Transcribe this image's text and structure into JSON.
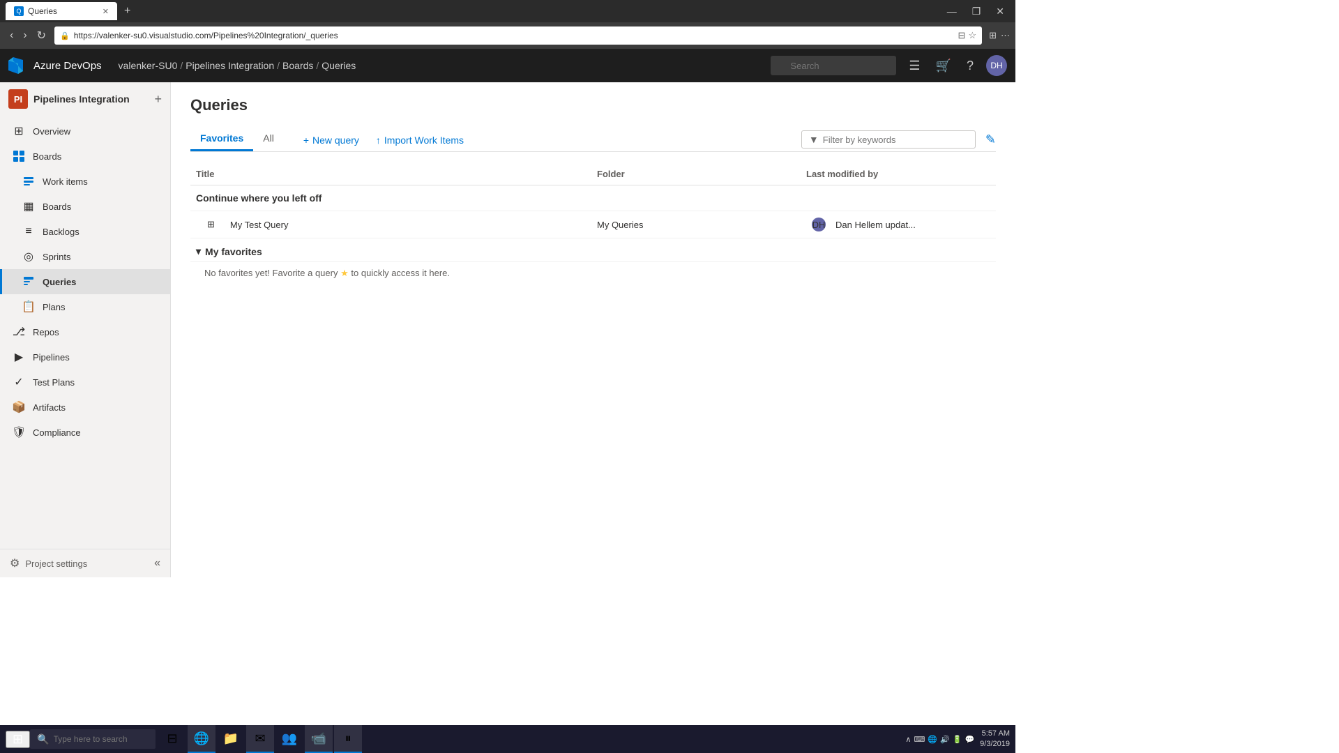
{
  "browser": {
    "tab_title": "Queries",
    "tab_icon": "Q",
    "url": "https://valenker-su0.visualstudio.com/Pipelines%20Integration/_queries",
    "new_tab_label": "+",
    "win_minimize": "—",
    "win_maximize": "❐",
    "win_close": "✕"
  },
  "topnav": {
    "brand": "Azure DevOps",
    "breadcrumb": [
      {
        "label": "valenker-SU0",
        "href": "#"
      },
      {
        "label": "Pipelines Integration",
        "href": "#"
      },
      {
        "label": "Boards",
        "href": "#"
      },
      {
        "label": "Queries",
        "href": "#"
      }
    ],
    "search_placeholder": "Search",
    "avatar_initials": "DH"
  },
  "sidebar": {
    "project_name": "Pipelines Integration",
    "project_icon": "PI",
    "nav_items": [
      {
        "id": "overview",
        "label": "Overview",
        "icon": "⊞"
      },
      {
        "id": "boards",
        "label": "Boards",
        "icon": "⊟"
      },
      {
        "id": "work-items",
        "label": "Work items",
        "icon": "☑"
      },
      {
        "id": "boards2",
        "label": "Boards",
        "icon": "▦"
      },
      {
        "id": "backlogs",
        "label": "Backlogs",
        "icon": "≡"
      },
      {
        "id": "sprints",
        "label": "Sprints",
        "icon": "◎"
      },
      {
        "id": "queries",
        "label": "Queries",
        "icon": "⊞",
        "active": true
      },
      {
        "id": "plans",
        "label": "Plans",
        "icon": "📋"
      },
      {
        "id": "repos",
        "label": "Repos",
        "icon": "⎇"
      },
      {
        "id": "pipelines",
        "label": "Pipelines",
        "icon": "▶"
      },
      {
        "id": "test-plans",
        "label": "Test Plans",
        "icon": "✓"
      },
      {
        "id": "artifacts",
        "label": "Artifacts",
        "icon": "📦"
      },
      {
        "id": "compliance",
        "label": "Compliance",
        "icon": "🛡"
      }
    ],
    "settings_label": "Project settings",
    "collapse_label": "«"
  },
  "content": {
    "page_title": "Queries",
    "tabs": [
      {
        "id": "favorites",
        "label": "Favorites",
        "active": true
      },
      {
        "id": "all",
        "label": "All"
      }
    ],
    "actions": [
      {
        "id": "new-query",
        "label": "New query",
        "icon": "+"
      },
      {
        "id": "import-work-items",
        "label": "Import Work Items",
        "icon": "↑"
      }
    ],
    "filter_placeholder": "Filter by keywords",
    "edit_icon": "✎",
    "table": {
      "columns": [
        "Title",
        "Folder",
        "Last modified by"
      ],
      "continue_section": {
        "title": "Continue where you left off",
        "rows": [
          {
            "title": "My Test Query",
            "icon": "⊞",
            "folder": "My Queries",
            "modified_by": "Dan Hellem updat...",
            "avatar_initials": "DH"
          }
        ]
      },
      "favorites_section": {
        "title": "My favorites",
        "collapsed": false,
        "no_favorites_text": "No favorites yet! Favorite a query",
        "star_icon": "★",
        "no_favorites_suffix": "to quickly access it here."
      }
    }
  },
  "taskbar": {
    "start_icon": "⊞",
    "search_placeholder": "Type here to search",
    "apps": [
      {
        "id": "task-view",
        "icon": "⊟",
        "active": false
      },
      {
        "id": "edge",
        "icon": "🌐",
        "active": true
      },
      {
        "id": "file-explorer",
        "icon": "📁",
        "active": false
      },
      {
        "id": "inbox",
        "icon": "✉",
        "active": true
      },
      {
        "id": "teams",
        "icon": "👥",
        "active": false
      },
      {
        "id": "camtasia",
        "icon": "📹",
        "active": false
      },
      {
        "id": "paused",
        "icon": "⏸",
        "active": false
      }
    ],
    "time": "5:57 AM",
    "date": "9/3/2019"
  }
}
